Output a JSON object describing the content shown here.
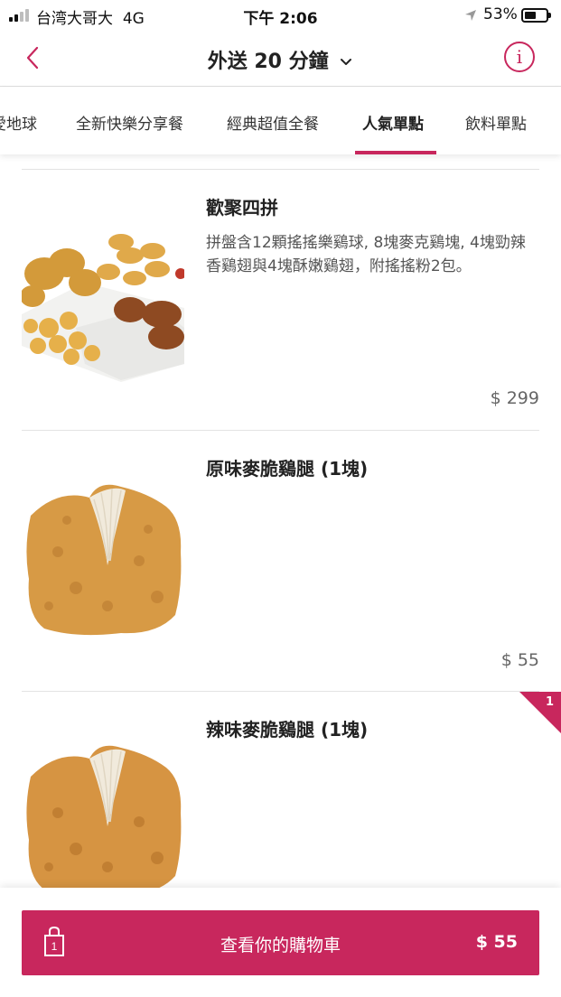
{
  "status_bar": {
    "carrier": "台湾大哥大",
    "network": "4G",
    "time": "下午 2:06",
    "battery": "53%"
  },
  "header": {
    "title": "外送 20 分鐘",
    "info_label": "i"
  },
  "tabs": [
    {
      "label": "愛地球",
      "active": false
    },
    {
      "label": "全新快樂分享餐",
      "active": false
    },
    {
      "label": "經典超值全餐",
      "active": false
    },
    {
      "label": "人氣單點",
      "active": true
    },
    {
      "label": "飲料單點",
      "active": false
    }
  ],
  "items": [
    {
      "name": "歡聚四拼",
      "description": "拼盤含12顆搖搖樂鷄球, 8塊麥克鷄塊, 4塊勁辣香鷄翅與4塊酥嫩鷄翅，附搖搖粉2包。",
      "price": "$ 299",
      "image": "fried-chicken-platter"
    },
    {
      "name": "原味麥脆鷄腿 (1塊)",
      "description": "",
      "price": "$ 55",
      "image": "fried-chicken-drumstick"
    },
    {
      "name": "辣味麥脆鷄腿 (1塊)",
      "description": "",
      "price": "",
      "badge": "1",
      "image": "spicy-fried-chicken-drumstick"
    }
  ],
  "cart": {
    "label": "查看你的購物車",
    "total": "$ 55",
    "count": "1"
  },
  "colors": {
    "accent": "#c8275d",
    "divider": "#e3e3e3"
  }
}
